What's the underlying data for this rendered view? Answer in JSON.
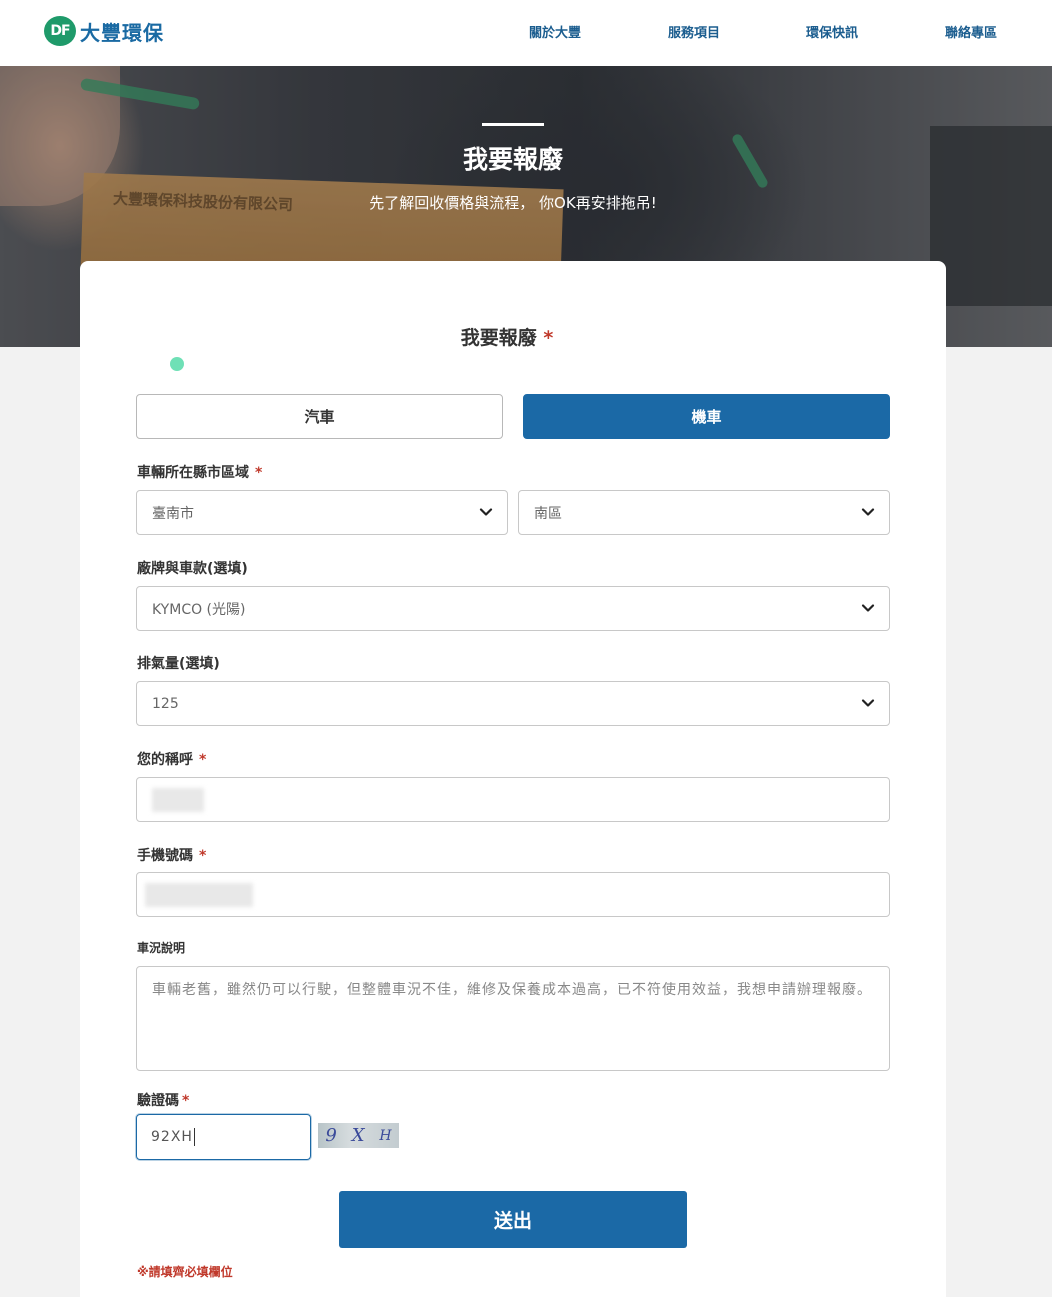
{
  "header": {
    "logo_mark": "DF",
    "logo_text": "大豐環保",
    "nav": [
      {
        "label": "關於大豐"
      },
      {
        "label": "服務項目"
      },
      {
        "label": "環保快訊"
      },
      {
        "label": "聯絡專區"
      }
    ]
  },
  "hero": {
    "title": "我要報廢",
    "subtitle": "先了解回收價格與流程， 你OK再安排拖吊!",
    "envelope_text": "大豐環保科技股份有限公司"
  },
  "form": {
    "title": "我要報廢",
    "required_mark": "*",
    "vehicle_types": [
      {
        "label": "汽車",
        "selected": false
      },
      {
        "label": "機車",
        "selected": true
      }
    ],
    "region": {
      "label": "車輛所在縣市區域",
      "city": "臺南市",
      "district": "南區"
    },
    "brand": {
      "label": "廠牌與車款(選填)",
      "value": "KYMCO (光陽)"
    },
    "displacement": {
      "label": "排氣量(選填)",
      "value": "125"
    },
    "name": {
      "label": "您的稱呼"
    },
    "phone": {
      "label": "手機號碼"
    },
    "description": {
      "label": "車況說明",
      "value": "車輛老舊，雖然仍可以行駛，但整體車況不佳，維修及保養成本過高，已不符使用效益，我想申請辦理報廢。"
    },
    "captcha": {
      "label": "驗證碼",
      "value": "92XH",
      "image_chars": [
        "9",
        "X",
        "H"
      ]
    },
    "submit_label": "送出",
    "note": "※請填齊必填欄位"
  },
  "colors": {
    "primary": "#1b69a6",
    "required": "#c0392b",
    "logo_green": "#1f9a6a"
  }
}
